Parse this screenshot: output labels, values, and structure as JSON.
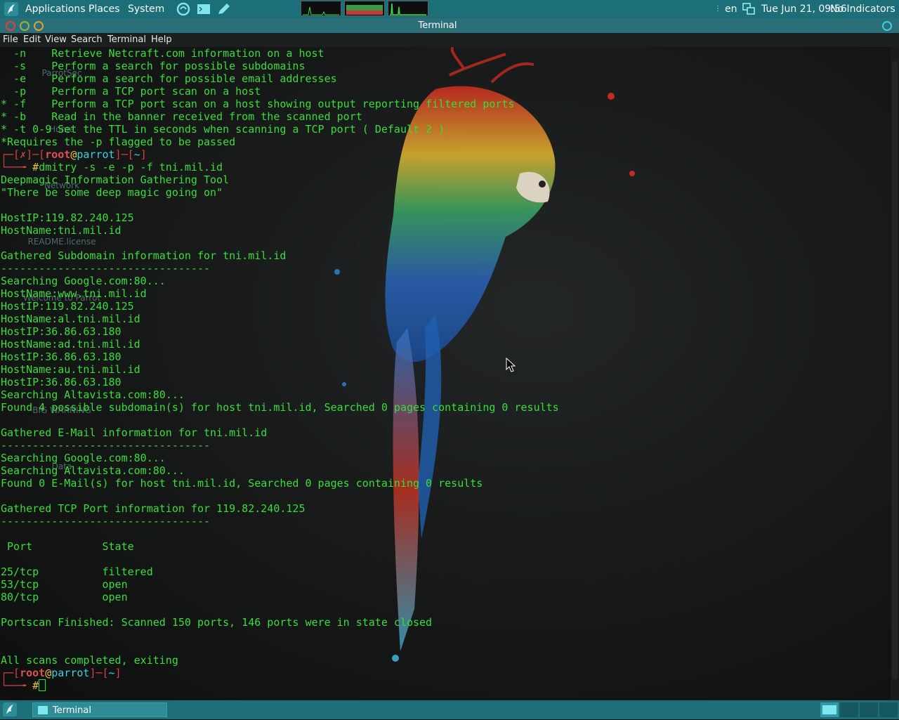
{
  "top_panel": {
    "menu": [
      "Applications",
      "Places",
      "System"
    ],
    "launchers": [
      "parrot-launcher-icon",
      "terminal-launcher-icon",
      "editor-launcher-icon"
    ],
    "keyboard_layout": "en",
    "clock": "Tue Jun 21, 09:56",
    "indicators": "No Indicators"
  },
  "window": {
    "title": "Terminal",
    "menu": [
      "File",
      "Edit",
      "View",
      "Search",
      "Terminal",
      "Help"
    ]
  },
  "desktop_icons": [
    "ParrotSec",
    "Home",
    "Network",
    "README.license",
    "Welcome to Parrot",
    "BIG WARNING",
    "Data"
  ],
  "terminal": {
    "lines": [
      {
        "text": "  -n    Retrieve Netcraft.com information on a host"
      },
      {
        "text": "  -s    Perform a search for possible subdomains"
      },
      {
        "text": "  -e    Perform a search for possible email addresses"
      },
      {
        "text": "  -p    Perform a TCP port scan on a host"
      },
      {
        "text": "* -f    Perform a TCP port scan on a host showing output reporting filtered ports"
      },
      {
        "text": "* -b    Read in the banner received from the scanned port"
      },
      {
        "text": "* -t 0-9 Set the TTL in seconds when scanning a TCP port ( Default 2 )"
      },
      {
        "text": "*Requires the -p flagged to be passed"
      },
      {
        "type": "prompt",
        "error": "✗",
        "user": "root",
        "host": "parrot",
        "path": "~"
      },
      {
        "type": "command",
        "text": "dmitry -s -e -p -f tni.mil.id"
      },
      {
        "text": "Deepmagic Information Gathering Tool"
      },
      {
        "text": "\"There be some deep magic going on\""
      },
      {
        "text": ""
      },
      {
        "text": "HostIP:119.82.240.125"
      },
      {
        "text": "HostName:tni.mil.id"
      },
      {
        "text": ""
      },
      {
        "text": "Gathered Subdomain information for tni.mil.id"
      },
      {
        "text": "---------------------------------"
      },
      {
        "text": "Searching Google.com:80..."
      },
      {
        "text": "HostName:www.tni.mil.id"
      },
      {
        "text": "HostIP:119.82.240.125"
      },
      {
        "text": "HostName:al.tni.mil.id"
      },
      {
        "text": "HostIP:36.86.63.180"
      },
      {
        "text": "HostName:ad.tni.mil.id"
      },
      {
        "text": "HostIP:36.86.63.180"
      },
      {
        "text": "HostName:au.tni.mil.id"
      },
      {
        "text": "HostIP:36.86.63.180"
      },
      {
        "text": "Searching Altavista.com:80..."
      },
      {
        "text": "Found 4 possible subdomain(s) for host tni.mil.id, Searched 0 pages containing 0 results"
      },
      {
        "text": ""
      },
      {
        "text": "Gathered E-Mail information for tni.mil.id"
      },
      {
        "text": "---------------------------------"
      },
      {
        "text": "Searching Google.com:80..."
      },
      {
        "text": "Searching Altavista.com:80..."
      },
      {
        "text": "Found 0 E-Mail(s) for host tni.mil.id, Searched 0 pages containing 0 results"
      },
      {
        "text": ""
      },
      {
        "text": "Gathered TCP Port information for 119.82.240.125"
      },
      {
        "text": "---------------------------------"
      },
      {
        "text": ""
      },
      {
        "text": " Port           State"
      },
      {
        "text": ""
      },
      {
        "text": "25/tcp          filtered"
      },
      {
        "text": "53/tcp          open"
      },
      {
        "text": "80/tcp          open"
      },
      {
        "text": ""
      },
      {
        "text": "Portscan Finished: Scanned 150 ports, 146 ports were in state closed"
      },
      {
        "text": ""
      },
      {
        "text": ""
      },
      {
        "text": "All scans completed, exiting"
      },
      {
        "type": "prompt",
        "error": "",
        "user": "root",
        "host": "parrot",
        "path": "~"
      },
      {
        "type": "command",
        "text": "",
        "cursor": true
      }
    ]
  },
  "bottom_panel": {
    "task": "Terminal"
  },
  "colors": {
    "panel": "#1c6f78",
    "terminal_text": "#39dd39",
    "prompt_bracket": "#d44040",
    "prompt_user": "#e05050",
    "prompt_at": "#f0c040",
    "prompt_host": "#3ad0e0"
  }
}
